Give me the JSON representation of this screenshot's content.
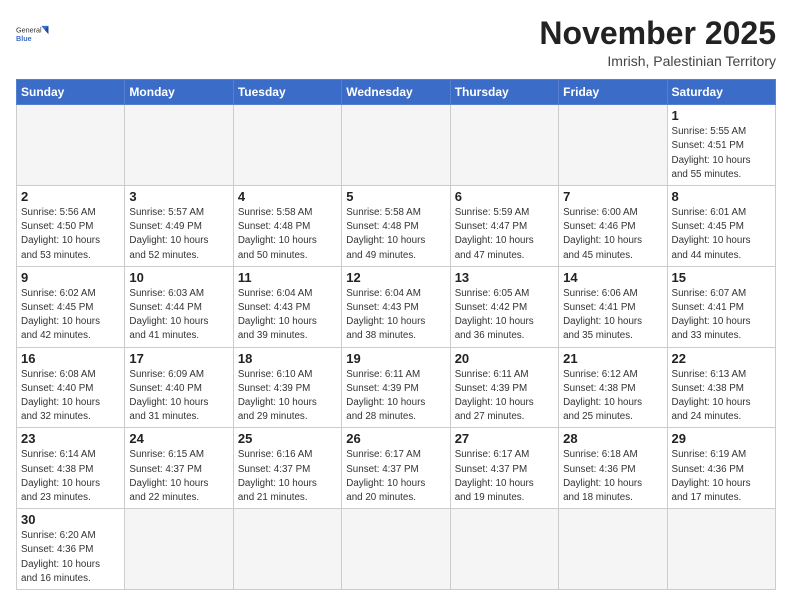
{
  "header": {
    "logo_general": "General",
    "logo_blue": "Blue",
    "title": "November 2025",
    "subtitle": "Imrish, Palestinian Territory"
  },
  "weekdays": [
    "Sunday",
    "Monday",
    "Tuesday",
    "Wednesday",
    "Thursday",
    "Friday",
    "Saturday"
  ],
  "weeks": [
    [
      {
        "day": "",
        "info": "",
        "empty": true
      },
      {
        "day": "",
        "info": "",
        "empty": true
      },
      {
        "day": "",
        "info": "",
        "empty": true
      },
      {
        "day": "",
        "info": "",
        "empty": true
      },
      {
        "day": "",
        "info": "",
        "empty": true
      },
      {
        "day": "",
        "info": "",
        "empty": true
      },
      {
        "day": "1",
        "info": "Sunrise: 5:55 AM\nSunset: 4:51 PM\nDaylight: 10 hours\nand 55 minutes.",
        "empty": false
      }
    ],
    [
      {
        "day": "2",
        "info": "Sunrise: 5:56 AM\nSunset: 4:50 PM\nDaylight: 10 hours\nand 53 minutes.",
        "empty": false
      },
      {
        "day": "3",
        "info": "Sunrise: 5:57 AM\nSunset: 4:49 PM\nDaylight: 10 hours\nand 52 minutes.",
        "empty": false
      },
      {
        "day": "4",
        "info": "Sunrise: 5:58 AM\nSunset: 4:48 PM\nDaylight: 10 hours\nand 50 minutes.",
        "empty": false
      },
      {
        "day": "5",
        "info": "Sunrise: 5:58 AM\nSunset: 4:48 PM\nDaylight: 10 hours\nand 49 minutes.",
        "empty": false
      },
      {
        "day": "6",
        "info": "Sunrise: 5:59 AM\nSunset: 4:47 PM\nDaylight: 10 hours\nand 47 minutes.",
        "empty": false
      },
      {
        "day": "7",
        "info": "Sunrise: 6:00 AM\nSunset: 4:46 PM\nDaylight: 10 hours\nand 45 minutes.",
        "empty": false
      },
      {
        "day": "8",
        "info": "Sunrise: 6:01 AM\nSunset: 4:45 PM\nDaylight: 10 hours\nand 44 minutes.",
        "empty": false
      }
    ],
    [
      {
        "day": "9",
        "info": "Sunrise: 6:02 AM\nSunset: 4:45 PM\nDaylight: 10 hours\nand 42 minutes.",
        "empty": false
      },
      {
        "day": "10",
        "info": "Sunrise: 6:03 AM\nSunset: 4:44 PM\nDaylight: 10 hours\nand 41 minutes.",
        "empty": false
      },
      {
        "day": "11",
        "info": "Sunrise: 6:04 AM\nSunset: 4:43 PM\nDaylight: 10 hours\nand 39 minutes.",
        "empty": false
      },
      {
        "day": "12",
        "info": "Sunrise: 6:04 AM\nSunset: 4:43 PM\nDaylight: 10 hours\nand 38 minutes.",
        "empty": false
      },
      {
        "day": "13",
        "info": "Sunrise: 6:05 AM\nSunset: 4:42 PM\nDaylight: 10 hours\nand 36 minutes.",
        "empty": false
      },
      {
        "day": "14",
        "info": "Sunrise: 6:06 AM\nSunset: 4:41 PM\nDaylight: 10 hours\nand 35 minutes.",
        "empty": false
      },
      {
        "day": "15",
        "info": "Sunrise: 6:07 AM\nSunset: 4:41 PM\nDaylight: 10 hours\nand 33 minutes.",
        "empty": false
      }
    ],
    [
      {
        "day": "16",
        "info": "Sunrise: 6:08 AM\nSunset: 4:40 PM\nDaylight: 10 hours\nand 32 minutes.",
        "empty": false
      },
      {
        "day": "17",
        "info": "Sunrise: 6:09 AM\nSunset: 4:40 PM\nDaylight: 10 hours\nand 31 minutes.",
        "empty": false
      },
      {
        "day": "18",
        "info": "Sunrise: 6:10 AM\nSunset: 4:39 PM\nDaylight: 10 hours\nand 29 minutes.",
        "empty": false
      },
      {
        "day": "19",
        "info": "Sunrise: 6:11 AM\nSunset: 4:39 PM\nDaylight: 10 hours\nand 28 minutes.",
        "empty": false
      },
      {
        "day": "20",
        "info": "Sunrise: 6:11 AM\nSunset: 4:39 PM\nDaylight: 10 hours\nand 27 minutes.",
        "empty": false
      },
      {
        "day": "21",
        "info": "Sunrise: 6:12 AM\nSunset: 4:38 PM\nDaylight: 10 hours\nand 25 minutes.",
        "empty": false
      },
      {
        "day": "22",
        "info": "Sunrise: 6:13 AM\nSunset: 4:38 PM\nDaylight: 10 hours\nand 24 minutes.",
        "empty": false
      }
    ],
    [
      {
        "day": "23",
        "info": "Sunrise: 6:14 AM\nSunset: 4:38 PM\nDaylight: 10 hours\nand 23 minutes.",
        "empty": false
      },
      {
        "day": "24",
        "info": "Sunrise: 6:15 AM\nSunset: 4:37 PM\nDaylight: 10 hours\nand 22 minutes.",
        "empty": false
      },
      {
        "day": "25",
        "info": "Sunrise: 6:16 AM\nSunset: 4:37 PM\nDaylight: 10 hours\nand 21 minutes.",
        "empty": false
      },
      {
        "day": "26",
        "info": "Sunrise: 6:17 AM\nSunset: 4:37 PM\nDaylight: 10 hours\nand 20 minutes.",
        "empty": false
      },
      {
        "day": "27",
        "info": "Sunrise: 6:17 AM\nSunset: 4:37 PM\nDaylight: 10 hours\nand 19 minutes.",
        "empty": false
      },
      {
        "day": "28",
        "info": "Sunrise: 6:18 AM\nSunset: 4:36 PM\nDaylight: 10 hours\nand 18 minutes.",
        "empty": false
      },
      {
        "day": "29",
        "info": "Sunrise: 6:19 AM\nSunset: 4:36 PM\nDaylight: 10 hours\nand 17 minutes.",
        "empty": false
      }
    ],
    [
      {
        "day": "30",
        "info": "Sunrise: 6:20 AM\nSunset: 4:36 PM\nDaylight: 10 hours\nand 16 minutes.",
        "empty": false
      },
      {
        "day": "",
        "info": "",
        "empty": true
      },
      {
        "day": "",
        "info": "",
        "empty": true
      },
      {
        "day": "",
        "info": "",
        "empty": true
      },
      {
        "day": "",
        "info": "",
        "empty": true
      },
      {
        "day": "",
        "info": "",
        "empty": true
      },
      {
        "day": "",
        "info": "",
        "empty": true
      }
    ]
  ]
}
